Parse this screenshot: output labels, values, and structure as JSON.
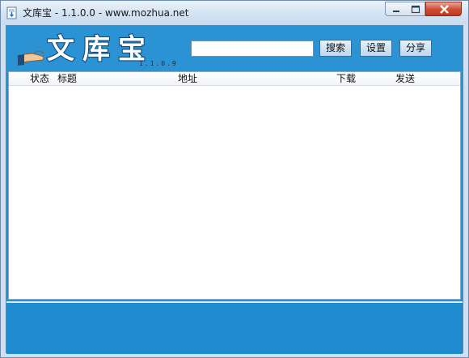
{
  "window": {
    "title": "文库宝 - 1.1.0.0 - www.mozhua.net",
    "app_icon": "document-download-icon",
    "controls": {
      "minimize": "minimize-icon",
      "maximize": "maximize-icon",
      "close": "close-icon"
    }
  },
  "header": {
    "logo_text": "文库宝",
    "version": "1.1.0.9",
    "search": {
      "value": "",
      "placeholder": ""
    },
    "buttons": {
      "search": "搜索",
      "settings": "设置",
      "share": "分享"
    }
  },
  "list": {
    "columns": [
      "状态",
      "标题",
      "地址",
      "下载",
      "发送"
    ],
    "rows": []
  },
  "colors": {
    "accent": "#2b93d3",
    "footer": "#1f8ccf",
    "titlebar": "#d3e3f3"
  }
}
